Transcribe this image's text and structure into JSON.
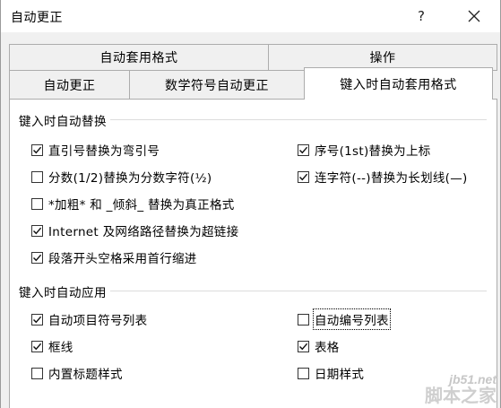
{
  "window": {
    "title": "自动更正",
    "help_label": "?"
  },
  "tabs": {
    "row1": [
      {
        "label": "自动套用格式"
      },
      {
        "label": "操作"
      }
    ],
    "row2": [
      {
        "label": "自动更正"
      },
      {
        "label": "数学符号自动更正"
      },
      {
        "label": "键入时自动套用格式",
        "active": true
      }
    ]
  },
  "groups": [
    {
      "title": "键入时自动替换",
      "options": [
        {
          "label": "直引号替换为弯引号",
          "checked": true
        },
        {
          "label": "序号(1st)替换为上标",
          "checked": true
        },
        {
          "label": "分数(1/2)替换为分数字符(½)",
          "checked": false
        },
        {
          "label": "连字符(--)替换为长划线(—)",
          "checked": true
        },
        {
          "label": "*加粗* 和 _倾斜_ 替换为真正格式",
          "checked": false
        },
        {
          "label": "Internet 及网络路径替换为超链接",
          "checked": true
        },
        {
          "label": "段落开头空格采用首行缩进",
          "checked": true
        }
      ]
    },
    {
      "title": "键入时自动应用",
      "options": [
        {
          "label": "自动项目符号列表",
          "checked": true
        },
        {
          "label": "自动编号列表",
          "checked": false,
          "focused": true
        },
        {
          "label": "框线",
          "checked": true
        },
        {
          "label": "表格",
          "checked": true
        },
        {
          "label": "内置标题样式",
          "checked": false
        },
        {
          "label": "日期样式",
          "checked": false
        }
      ]
    }
  ],
  "watermark": {
    "url": "jb51.net",
    "name": "脚本之家"
  },
  "colors": {
    "panel_bg": "#ffffff",
    "dialog_bg": "#f0f0f0",
    "border": "#acacac"
  }
}
